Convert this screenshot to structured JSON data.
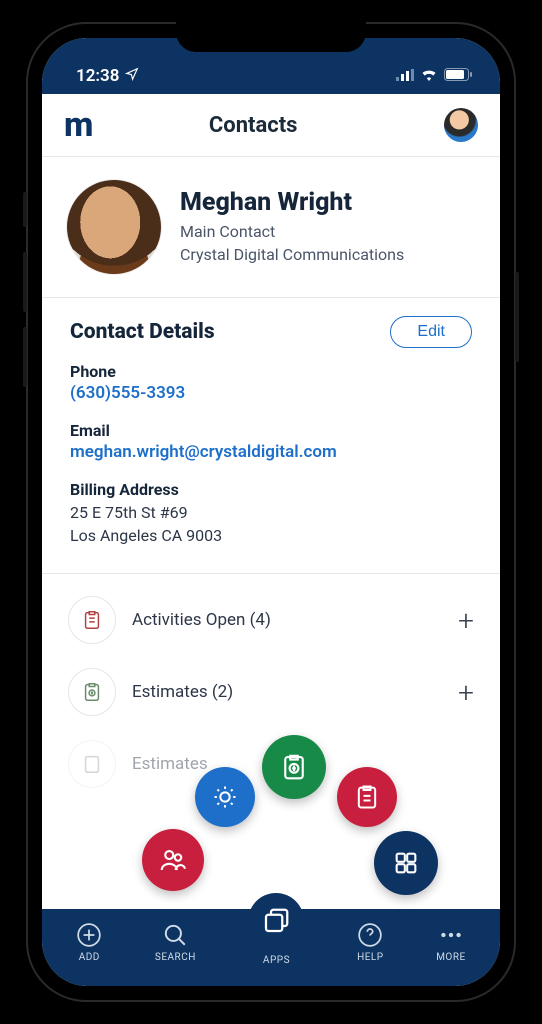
{
  "status": {
    "time": "12:38"
  },
  "header": {
    "logo": "m",
    "title": "Contacts"
  },
  "contact": {
    "name": "Meghan Wright",
    "role": "Main Contact",
    "company": "Crystal Digital Communications"
  },
  "details": {
    "section_title": "Contact Details",
    "edit_label": "Edit",
    "phone_label": "Phone",
    "phone_value": "(630)555-3393",
    "email_label": "Email",
    "email_value": "meghan.wright@crystaldigital.com",
    "billing_label": "Billing Address",
    "billing_line1": "25 E 75th St #69",
    "billing_line2": "Los Angeles CA 9003"
  },
  "lists": {
    "activities_label": "Activities Open (4)",
    "estimates_label": "Estimates (2)",
    "estimates2_label": "Estimates"
  },
  "nav": {
    "add": "ADD",
    "search": "SEARCH",
    "apps": "APPS",
    "help": "HELP",
    "more": "MORE"
  }
}
